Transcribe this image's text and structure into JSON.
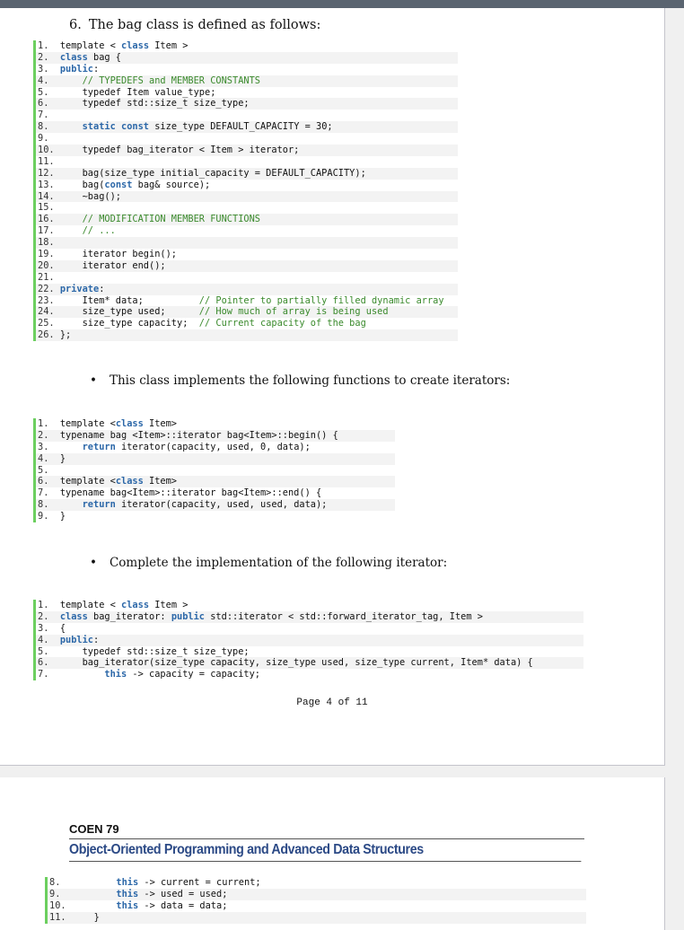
{
  "question": {
    "number": "6.",
    "text": "The bag class is defined as follows:"
  },
  "code_blocks": {
    "bag_class": [
      {
        "n": "1.",
        "ind": "  ",
        "parts": [
          [
            "",
            "template < "
          ],
          [
            "kw",
            "class"
          ],
          [
            "",
            " Item >"
          ]
        ]
      },
      {
        "n": "2.",
        "ind": "  ",
        "parts": [
          [
            "kw",
            "class"
          ],
          [
            "",
            " bag {"
          ]
        ]
      },
      {
        "n": "3.",
        "ind": "  ",
        "parts": [
          [
            "kw",
            "public"
          ],
          [
            "",
            ":"
          ]
        ]
      },
      {
        "n": "4.",
        "ind": "      ",
        "parts": [
          [
            "cm",
            "// TYPEDEFS and MEMBER CONSTANTS"
          ]
        ]
      },
      {
        "n": "5.",
        "ind": "      ",
        "parts": [
          [
            "",
            "typedef Item value_type;"
          ]
        ]
      },
      {
        "n": "6.",
        "ind": "      ",
        "parts": [
          [
            "",
            "typedef std::size_t size_type;"
          ]
        ]
      },
      {
        "n": "7.",
        "ind": "",
        "parts": []
      },
      {
        "n": "8.",
        "ind": "      ",
        "parts": [
          [
            "kw",
            "static const"
          ],
          [
            "",
            " size_type DEFAULT_CAPACITY = 30;"
          ]
        ]
      },
      {
        "n": "9.",
        "ind": "",
        "parts": []
      },
      {
        "n": "10.",
        "ind": "     ",
        "parts": [
          [
            "",
            "typedef bag_iterator < Item > iterator;"
          ]
        ]
      },
      {
        "n": "11.",
        "ind": "",
        "parts": []
      },
      {
        "n": "12.",
        "ind": "     ",
        "parts": [
          [
            "",
            "bag(size_type initial_capacity = DEFAULT_CAPACITY);"
          ]
        ]
      },
      {
        "n": "13.",
        "ind": "     ",
        "parts": [
          [
            "",
            "bag("
          ],
          [
            "kw",
            "const"
          ],
          [
            "",
            " bag& source);"
          ]
        ]
      },
      {
        "n": "14.",
        "ind": "     ",
        "parts": [
          [
            "",
            "~bag();"
          ]
        ]
      },
      {
        "n": "15.",
        "ind": "",
        "parts": []
      },
      {
        "n": "16.",
        "ind": "     ",
        "parts": [
          [
            "cm",
            "// MODIFICATION MEMBER FUNCTIONS"
          ]
        ]
      },
      {
        "n": "17.",
        "ind": "     ",
        "parts": [
          [
            "cm",
            "// ..."
          ]
        ]
      },
      {
        "n": "18.",
        "ind": "",
        "parts": []
      },
      {
        "n": "19.",
        "ind": "     ",
        "parts": [
          [
            "",
            "iterator begin();"
          ]
        ]
      },
      {
        "n": "20.",
        "ind": "     ",
        "parts": [
          [
            "",
            "iterator end();"
          ]
        ]
      },
      {
        "n": "21.",
        "ind": "",
        "parts": []
      },
      {
        "n": "22.",
        "ind": " ",
        "parts": [
          [
            "kw",
            "private"
          ],
          [
            "",
            ":"
          ]
        ]
      },
      {
        "n": "23.",
        "ind": "     ",
        "parts": [
          [
            "",
            "Item* data;          "
          ],
          [
            "cm",
            "// Pointer to partially filled dynamic array"
          ]
        ]
      },
      {
        "n": "24.",
        "ind": "     ",
        "parts": [
          [
            "",
            "size_type used;      "
          ],
          [
            "cm",
            "// How much of array is being used"
          ]
        ]
      },
      {
        "n": "25.",
        "ind": "     ",
        "parts": [
          [
            "",
            "size_type capacity;  "
          ],
          [
            "cm",
            "// Current capacity of the bag"
          ]
        ]
      },
      {
        "n": "26.",
        "ind": " ",
        "parts": [
          [
            "",
            "};"
          ]
        ]
      }
    ],
    "iterator_funcs": [
      {
        "n": "1.",
        "ind": "  ",
        "parts": [
          [
            "",
            "template <"
          ],
          [
            "kw",
            "class"
          ],
          [
            "",
            " Item>"
          ]
        ]
      },
      {
        "n": "2.",
        "ind": "  ",
        "parts": [
          [
            "",
            "typename bag <Item>::iterator bag<Item>::begin() {"
          ]
        ]
      },
      {
        "n": "3.",
        "ind": "      ",
        "parts": [
          [
            "kw",
            "return"
          ],
          [
            "",
            " iterator(capacity, used, 0, data);"
          ]
        ]
      },
      {
        "n": "4.",
        "ind": "  ",
        "parts": [
          [
            "",
            "}"
          ]
        ]
      },
      {
        "n": "5.",
        "ind": "",
        "parts": []
      },
      {
        "n": "6.",
        "ind": "  ",
        "parts": [
          [
            "",
            "template <"
          ],
          [
            "kw",
            "class"
          ],
          [
            "",
            " Item>"
          ]
        ]
      },
      {
        "n": "7.",
        "ind": "  ",
        "parts": [
          [
            "",
            "typename bag<Item>::iterator bag<Item>::end() {"
          ]
        ]
      },
      {
        "n": "8.",
        "ind": "      ",
        "parts": [
          [
            "kw",
            "return"
          ],
          [
            "",
            " iterator(capacity, used, used, data);"
          ]
        ]
      },
      {
        "n": "9.",
        "ind": "  ",
        "parts": [
          [
            "",
            "}"
          ]
        ]
      }
    ],
    "bag_iterator": [
      {
        "n": "1.",
        "ind": "  ",
        "parts": [
          [
            "",
            "template < "
          ],
          [
            "kw",
            "class"
          ],
          [
            "",
            " Item >"
          ]
        ]
      },
      {
        "n": "2.",
        "ind": "  ",
        "parts": [
          [
            "kw",
            "class"
          ],
          [
            "",
            " bag_iterator: "
          ],
          [
            "kw",
            "public"
          ],
          [
            "",
            " std::iterator < std::forward_iterator_tag, Item >"
          ]
        ]
      },
      {
        "n": "3.",
        "ind": "  ",
        "parts": [
          [
            "",
            "{"
          ]
        ]
      },
      {
        "n": "4.",
        "ind": "  ",
        "parts": [
          [
            "kw",
            "public"
          ],
          [
            "",
            ":"
          ]
        ]
      },
      {
        "n": "5.",
        "ind": "      ",
        "parts": [
          [
            "",
            "typedef std::size_t size_type;"
          ]
        ]
      },
      {
        "n": "6.",
        "ind": "      ",
        "parts": [
          [
            "",
            "bag_iterator(size_type capacity, size_type used, size_type current, Item* data) {"
          ]
        ]
      },
      {
        "n": "7.",
        "ind": "          ",
        "parts": [
          [
            "kw",
            "this"
          ],
          [
            "",
            " -> capacity = capacity;"
          ]
        ]
      }
    ],
    "bag_iterator_cont": [
      {
        "n": "8.",
        "ind": "          ",
        "parts": [
          [
            "kw",
            "this"
          ],
          [
            "",
            " -> current = current;"
          ]
        ]
      },
      {
        "n": "9.",
        "ind": "          ",
        "parts": [
          [
            "kw",
            "this"
          ],
          [
            "",
            " -> used = used;"
          ]
        ]
      },
      {
        "n": "10.",
        "ind": "         ",
        "parts": [
          [
            "kw",
            "this"
          ],
          [
            "",
            " -> data = data;"
          ]
        ]
      },
      {
        "n": "11.",
        "ind": "     ",
        "parts": [
          [
            "",
            "}"
          ]
        ]
      }
    ]
  },
  "bullets": {
    "iterators_intro": "This class implements the following functions to create iterators:",
    "complete_impl": "Complete the implementation of the following iterator:"
  },
  "footer": {
    "page_label": "Page 4 of 11"
  },
  "header": {
    "course_code": "COEN 79",
    "course_title": "Object-Oriented Programming and Advanced Data Structures"
  }
}
